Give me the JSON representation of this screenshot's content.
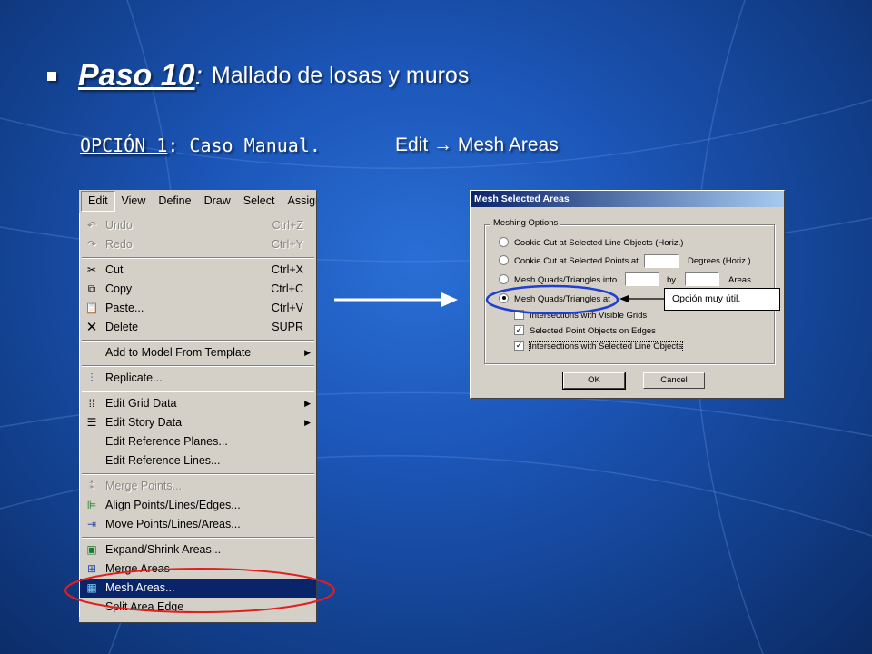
{
  "slide": {
    "title_bold": "Paso 10",
    "title_colon": ":",
    "title_rest": "Mallado de losas y muros",
    "subtitle_option": "OPCIÓN 1",
    "subtitle_case": ": Caso Manual.",
    "subtitle_edit": "Edit → Mesh Areas"
  },
  "menu": {
    "menubar": [
      "Edit",
      "View",
      "Define",
      "Draw",
      "Select",
      "Assign"
    ],
    "items": [
      {
        "label": "Undo",
        "shortcut": "Ctrl+Z",
        "icon": "undo-icon",
        "disabled": true
      },
      {
        "label": "Redo",
        "shortcut": "Ctrl+Y",
        "icon": "redo-icon",
        "disabled": true
      },
      {
        "label": "Cut",
        "shortcut": "Ctrl+X",
        "icon": "scissors-icon"
      },
      {
        "label": "Copy",
        "shortcut": "Ctrl+C",
        "icon": "copy-icon"
      },
      {
        "label": "Paste...",
        "shortcut": "Ctrl+V",
        "icon": "paste-icon"
      },
      {
        "label": "Delete",
        "shortcut": "SUPR",
        "icon": "delete-icon"
      },
      {
        "label": "Add to Model From Template",
        "submenu": true
      },
      {
        "label": "Replicate...",
        "icon": "replicate-icon"
      },
      {
        "label": "Edit Grid Data",
        "icon": "grid-icon",
        "submenu": true
      },
      {
        "label": "Edit Story Data",
        "icon": "story-icon",
        "submenu": true
      },
      {
        "label": "Edit Reference Planes..."
      },
      {
        "label": "Edit Reference Lines..."
      },
      {
        "label": "Merge Points...",
        "icon": "merge-points-icon",
        "disabled": true
      },
      {
        "label": "Align Points/Lines/Edges...",
        "icon": "align-icon"
      },
      {
        "label": "Move Points/Lines/Areas...",
        "icon": "move-icon"
      },
      {
        "label": "Expand/Shrink Areas...",
        "icon": "expand-icon"
      },
      {
        "label": "Merge Areas",
        "icon": "merge-areas-icon"
      },
      {
        "label": "Mesh Areas...",
        "icon": "mesh-icon",
        "highlighted": true
      },
      {
        "label": "Split Area Edge"
      }
    ]
  },
  "dialog": {
    "title": "Mesh Selected Areas",
    "group_label": "Meshing Options",
    "option_cookie_lines": "Cookie Cut at Selected Line Objects (Horiz.)",
    "option_cookie_points": "Cookie Cut at Selected Points at",
    "degrees_label": "Degrees (Horiz.)",
    "option_mesh_into": "Mesh Quads/Triangles into",
    "by_label": "by",
    "areas_label": "Areas",
    "option_mesh_at": "Mesh Quads/Triangles at",
    "check_visible_grids": "Intersections with Visible Grids",
    "check_point_objects": "Selected Point Objects on Edges",
    "check_line_objects": "Intersections with Selected Line Objects",
    "ok_label": "OK",
    "cancel_label": "Cancel",
    "selected_option": "option_mesh_at",
    "checks": {
      "visible_grids": false,
      "point_objects": true,
      "line_objects": true
    }
  },
  "callout": {
    "text": "Opción muy útil."
  },
  "colors": {
    "highlight_ellipse": "#e02020",
    "focus_ellipse": "#1f3fd0",
    "menu_highlight": "#0a246a"
  }
}
